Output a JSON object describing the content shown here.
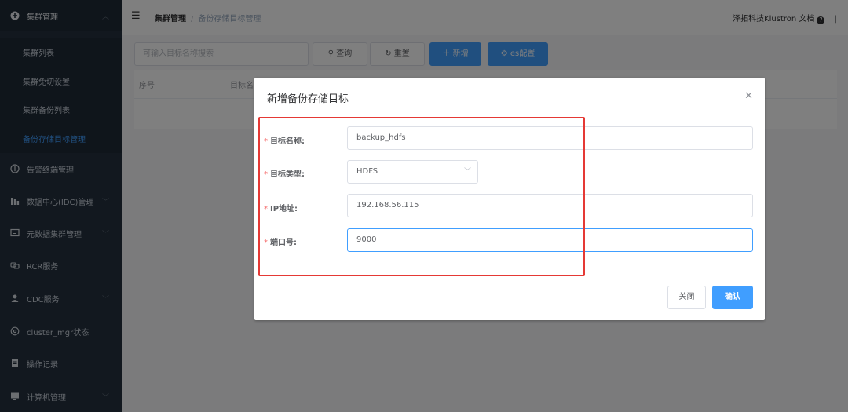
{
  "sidebar": {
    "cluster_mgmt": "集群管理",
    "sub_items": [
      {
        "label": "集群列表"
      },
      {
        "label": "集群免切设置"
      },
      {
        "label": "集群备份列表"
      },
      {
        "label": "备份存储目标管理"
      }
    ],
    "items": [
      {
        "label": "告警终端管理",
        "icon": "info-circle-icon"
      },
      {
        "label": "数据中心(IDC)管理",
        "icon": "bar-chart-icon"
      },
      {
        "label": "元数据集群管理",
        "icon": "monitor-icon"
      },
      {
        "label": "RCR服务",
        "icon": "link-icon"
      },
      {
        "label": "CDC服务",
        "icon": "user-icon"
      },
      {
        "label": "cluster_mgr状态",
        "icon": "settings-icon"
      },
      {
        "label": "操作记录",
        "icon": "document-icon"
      },
      {
        "label": "计算机管理",
        "icon": "computer-icon"
      }
    ]
  },
  "header": {
    "breadcrumb_root": "集群管理",
    "breadcrumb_sep": "/",
    "breadcrumb_current": "备份存储目标管理",
    "right_text": "泽拓科技Klustron 文档",
    "help_glyph": "?",
    "divider": "|"
  },
  "toolbar": {
    "search_placeholder": "可输入目标名称搜索",
    "query_label": "查询",
    "reset_label": "重置",
    "add_label": "新增",
    "es_label": "es配置"
  },
  "table": {
    "columns": [
      "序号",
      "目标名"
    ]
  },
  "dialog": {
    "title": "新增备份存储目标",
    "fields": [
      {
        "label": "目标名称:",
        "value": "backup_hdfs"
      },
      {
        "label": "目标类型:",
        "value": "HDFS"
      },
      {
        "label": "IP地址:",
        "value": "192.168.56.115"
      },
      {
        "label": "端口号:",
        "value": "9000"
      }
    ],
    "cancel_label": "关闭",
    "ok_label": "确认"
  },
  "colors": {
    "sidebar_bg": "#25313f",
    "accent": "#409eff",
    "highlight_box": "#e53935"
  }
}
